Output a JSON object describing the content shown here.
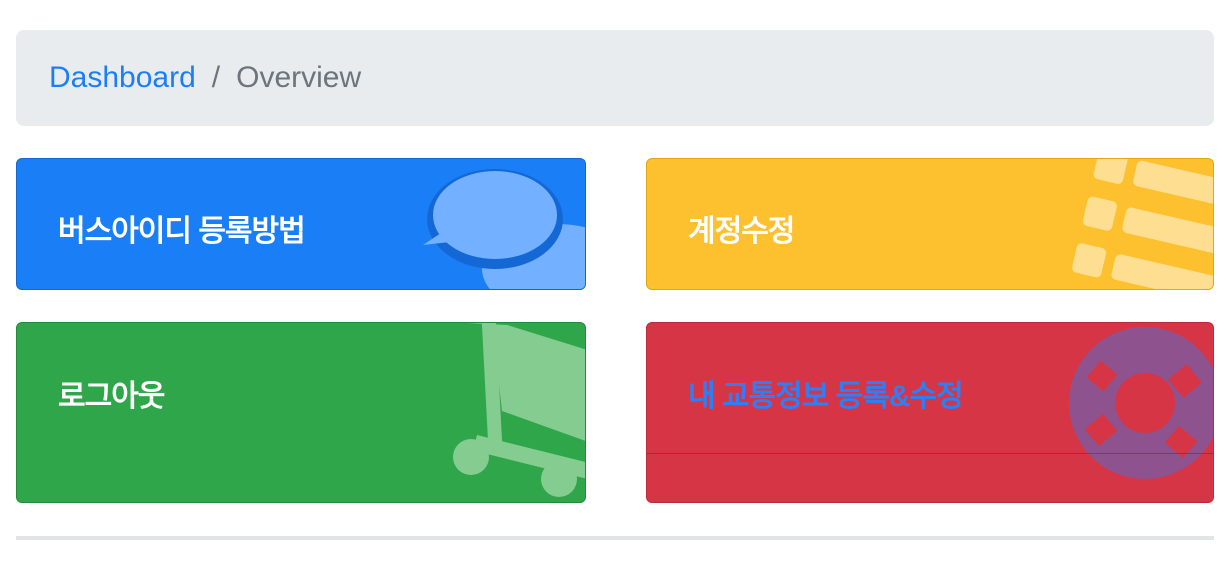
{
  "breadcrumb": {
    "link": "Dashboard",
    "separator": "/",
    "current": "Overview"
  },
  "cards": [
    {
      "label": "버스아이디 등록방법",
      "color": "#1a7ef7",
      "icon": "speech-bubble-icon"
    },
    {
      "label": "계정수정",
      "color": "#fdc02f",
      "icon": "list-icon"
    },
    {
      "label": "로그아웃",
      "color": "#2fa64a",
      "icon": "shopping-cart-icon"
    },
    {
      "label": "내 교통정보 등록&수정",
      "color": "#d63545",
      "icon": "life-ring-icon"
    }
  ]
}
